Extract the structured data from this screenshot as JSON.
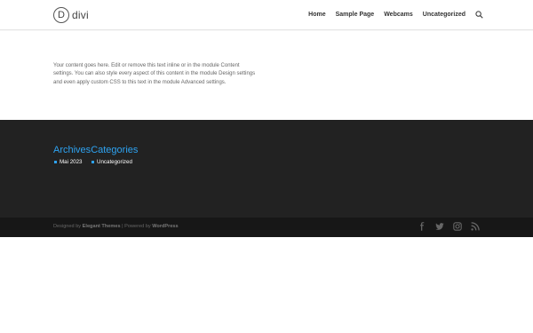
{
  "logo": {
    "mark": "D",
    "text": "divi"
  },
  "nav": {
    "items": [
      "Home",
      "Sample Page",
      "Webcams",
      "Uncategorized"
    ],
    "search_icon": "search-icon"
  },
  "content": {
    "paragraph": "Your content goes here. Edit or remove this text inline or in the module Content settings. You can also style every aspect of this content in the module Design settings and even apply custom CSS to this text in the module Advanced settings."
  },
  "footer": {
    "archives_title": "Archives",
    "archives_items": [
      "Mai 2023"
    ],
    "categories_title": "Categories",
    "categories_items": [
      "Uncategorized"
    ],
    "credits": {
      "prefix": "Designed by ",
      "designer": "Elegant Themes",
      "separator": " | Powered by ",
      "platform": "WordPress"
    },
    "social_icons": [
      "facebook-icon",
      "twitter-icon",
      "instagram-icon",
      "rss-icon"
    ]
  },
  "colors": {
    "accent": "#2ea3f2",
    "footer_bg": "#222222",
    "bottom_bar_bg": "#171717",
    "header_bg": "#ffffff"
  }
}
